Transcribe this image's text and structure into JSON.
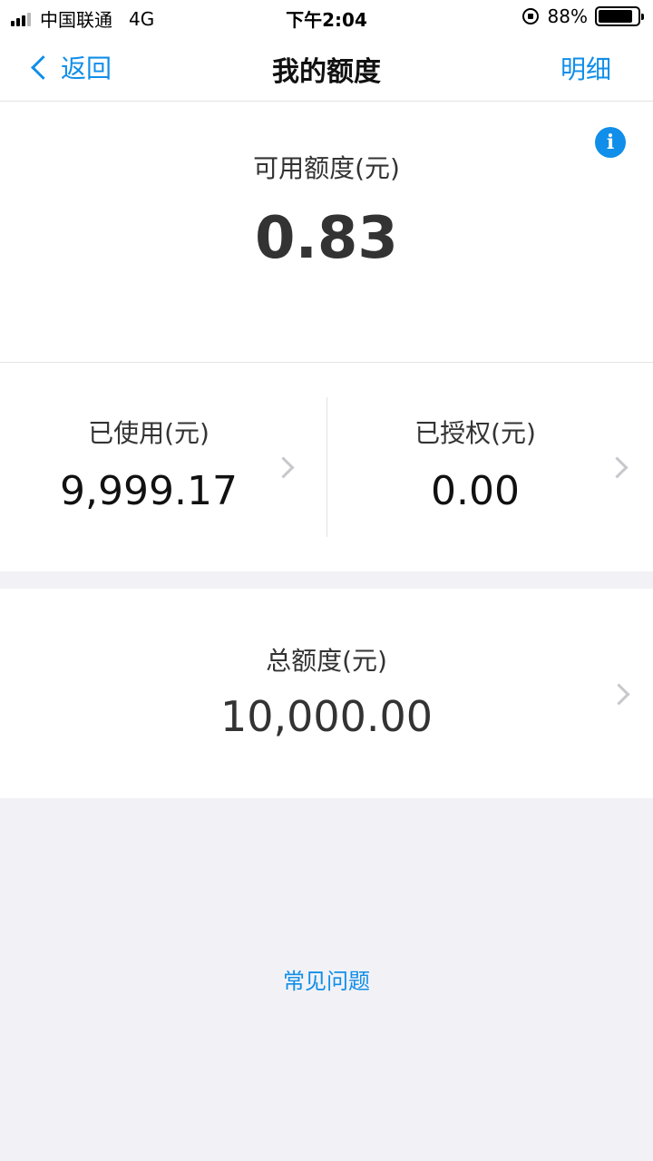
{
  "status_bar": {
    "carrier": "中国联通",
    "network": "4G",
    "time": "下午2:04",
    "battery_percent_text": "88%",
    "battery_level": 0.88
  },
  "nav": {
    "back_label": "返回",
    "title": "我的额度",
    "detail_label": "明细"
  },
  "available": {
    "label": "可用额度(元)",
    "value": "0.83",
    "info_icon_text": "i"
  },
  "used": {
    "label": "已使用(元)",
    "value": "9,999.17"
  },
  "authorized": {
    "label": "已授权(元)",
    "value": "0.00"
  },
  "total": {
    "label": "总额度(元)",
    "value": "10,000.00"
  },
  "faq": {
    "label": "常见问题"
  },
  "colors": {
    "accent": "#108ee9",
    "background": "#f2f2f6"
  }
}
